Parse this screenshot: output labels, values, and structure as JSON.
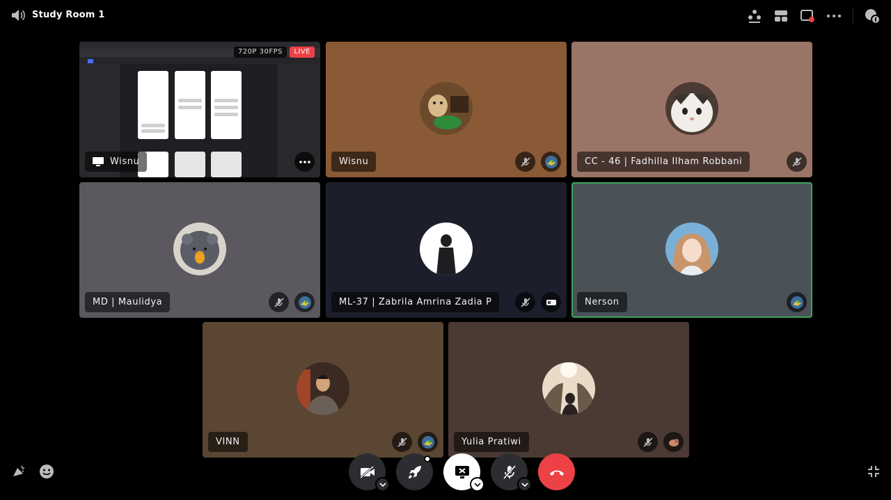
{
  "room": {
    "title": "Study Room 1"
  },
  "stream": {
    "sharer": "Wisnu",
    "quality": "720P 30FPS",
    "live_label": "LIVE"
  },
  "participants": [
    {
      "name": "Wisnu",
      "bg": "#8a5a36"
    },
    {
      "name": "CC - 46 | Fadhilla Ilham Robbani",
      "bg": "#9a7466"
    },
    {
      "name": "MD | Maulidya",
      "bg": "#5b585f"
    },
    {
      "name": "ML-37 | Zabrila Amrina Zadia P",
      "bg": "#1c1f2b"
    },
    {
      "name": "Nerson",
      "bg": "#4a5258"
    },
    {
      "name": "VINN",
      "bg": "#5a4632"
    },
    {
      "name": "Yulia Pratiwi",
      "bg": "#4a3a33"
    }
  ],
  "colors": {
    "accent_red": "#ed4245",
    "speaking_green": "#3ba55c",
    "button_dark": "#2b2d31"
  },
  "icons": {
    "top": [
      "activity-icon",
      "layout-grid-icon",
      "popout-icon",
      "more-icon",
      "inbox-icon"
    ],
    "controls": [
      "camera-off-icon",
      "activities-rocket-icon",
      "screen-share-stop-icon",
      "mic-muted-icon",
      "hang-up-icon"
    ],
    "bottom_left": [
      "soundboard-icon",
      "emoji-icon"
    ],
    "bottom_right": "exit-fullscreen-icon"
  }
}
